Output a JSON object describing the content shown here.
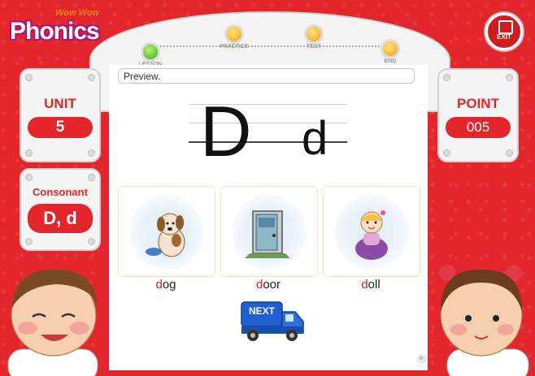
{
  "logo": {
    "small": "Wow Wow",
    "main": "Phonics"
  },
  "exit": {
    "label": "EXIT"
  },
  "progress": {
    "steps": [
      {
        "label": "LESSON",
        "state": "active"
      },
      {
        "label": "PRACTICE",
        "state": "pending"
      },
      {
        "label": "TEST",
        "state": "pending"
      },
      {
        "label": "END",
        "state": "pending"
      }
    ]
  },
  "preview": {
    "text": "Preview."
  },
  "letters": {
    "upper": "D",
    "lower": "d"
  },
  "unit": {
    "label": "UNIT",
    "value": "5"
  },
  "category": {
    "label": "Consonant",
    "value": "D, d"
  },
  "point": {
    "label": "POINT",
    "value": "005"
  },
  "words": [
    {
      "first": "d",
      "rest": "og",
      "icon": "dog-picture"
    },
    {
      "first": "d",
      "rest": "oor",
      "icon": "door-picture"
    },
    {
      "first": "d",
      "rest": "oll",
      "icon": "doll-picture"
    }
  ],
  "next": {
    "label": "NEXT"
  },
  "colors": {
    "frame": "#e3262b",
    "accent": "#e21d23",
    "lesson_done": "#3fa31f",
    "pending": "#f0a417",
    "truck": "#1f5fd1"
  }
}
